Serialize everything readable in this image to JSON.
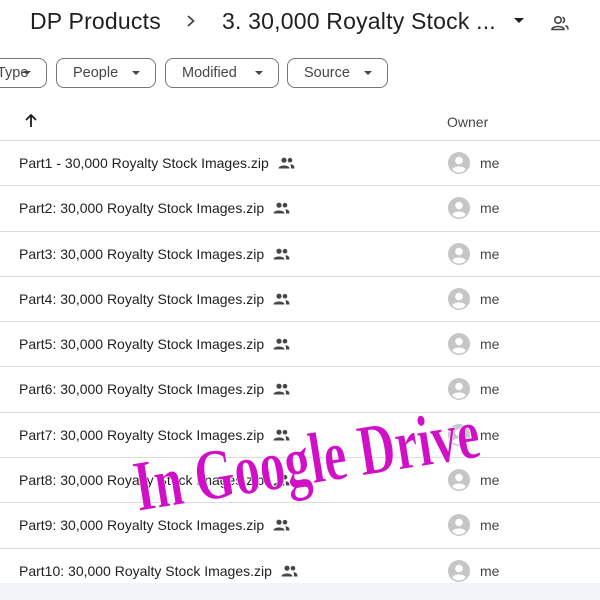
{
  "breadcrumb": {
    "root": "DP Products",
    "current": "3. 30,000 Royalty Stock ..."
  },
  "filters": {
    "type": "Type",
    "people": "People",
    "modified": "Modified",
    "source": "Source"
  },
  "columns": {
    "owner": "Owner"
  },
  "files": [
    {
      "name": "Part1 - 30,000 Royalty Stock Images.zip",
      "owner": "me"
    },
    {
      "name": "Part2: 30,000 Royalty Stock Images.zip",
      "owner": "me"
    },
    {
      "name": "Part3: 30,000 Royalty Stock Images.zip",
      "owner": "me"
    },
    {
      "name": "Part4: 30,000 Royalty Stock Images.zip",
      "owner": "me"
    },
    {
      "name": "Part5: 30,000 Royalty Stock Images.zip",
      "owner": "me"
    },
    {
      "name": "Part6: 30,000 Royalty Stock Images.zip",
      "owner": "me"
    },
    {
      "name": "Part7: 30,000 Royalty Stock Images.zip",
      "owner": "me"
    },
    {
      "name": "Part8: 30,000 Royalty Stock Images.zip",
      "owner": "me"
    },
    {
      "name": "Part9: 30,000 Royalty Stock Images.zip",
      "owner": "me"
    },
    {
      "name": "Part10: 30,000 Royalty Stock Images.zip",
      "owner": "me"
    }
  ],
  "overlay_text": "In Google Drive",
  "icons": {
    "separator": "chevron-right-icon",
    "share": "people-icon",
    "sort": "arrow-up-icon",
    "avatar": "account-circle-icon"
  },
  "colors": {
    "overlay": "#d10fc7",
    "border": "#dadce0",
    "text": "#1f1f1f",
    "secondary_text": "#444746",
    "avatar": "#c4c7c5"
  }
}
